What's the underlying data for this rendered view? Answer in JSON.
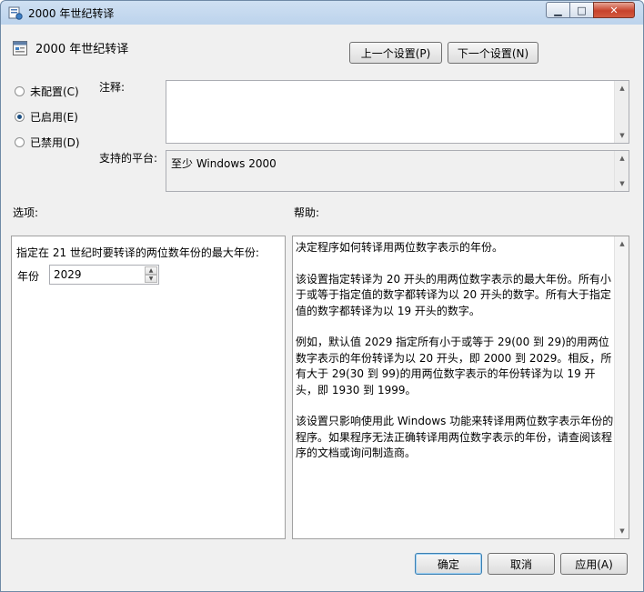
{
  "window": {
    "title": "2000 年世纪转译"
  },
  "header": {
    "policy_title": "2000 年世纪转译",
    "prev_button": "上一个设置(P)",
    "next_button": "下一个设置(N)"
  },
  "state": {
    "radios": [
      {
        "label": "未配置(C)",
        "checked": false
      },
      {
        "label": "已启用(E)",
        "checked": true
      },
      {
        "label": "已禁用(D)",
        "checked": false
      }
    ]
  },
  "comment": {
    "label": "注释:",
    "value": ""
  },
  "platform": {
    "label": "支持的平台:",
    "value": "至少 Windows 2000"
  },
  "options": {
    "section_label": "选项:",
    "description": "指定在 21 世纪时要转译的两位数年份的最大年份:",
    "year_label": "年份",
    "year_value": "2029"
  },
  "help": {
    "section_label": "帮助:",
    "paragraphs": [
      "决定程序如何转译用两位数字表示的年份。",
      "该设置指定转译为 20 开头的用两位数字表示的最大年份。所有小于或等于指定值的数字都转译为以 20 开头的数字。所有大于指定值的数字都转译为以 19 开头的数字。",
      "例如，默认值 2029 指定所有小于或等于 29(00 到 29)的用两位数字表示的年份转译为以 20 开头，即 2000 到 2029。相反，所有大于 29(30 到 99)的用两位数字表示的年份转译为以 19 开头，即 1930 到 1999。",
      "该设置只影响使用此 Windows 功能来转译用两位数字表示年份的程序。如果程序无法正确转译用两位数字表示的年份，请查阅该程序的文档或询问制造商。"
    ]
  },
  "footer": {
    "ok_button": "确定",
    "cancel_button": "取消",
    "apply_button": "应用(A)"
  },
  "icons": {
    "title_icon": "policy-window-icon",
    "policy_icon": "policy-setting-icon",
    "minimize": "minimize-icon",
    "maximize": "maximize-icon",
    "close": "close-icon"
  }
}
